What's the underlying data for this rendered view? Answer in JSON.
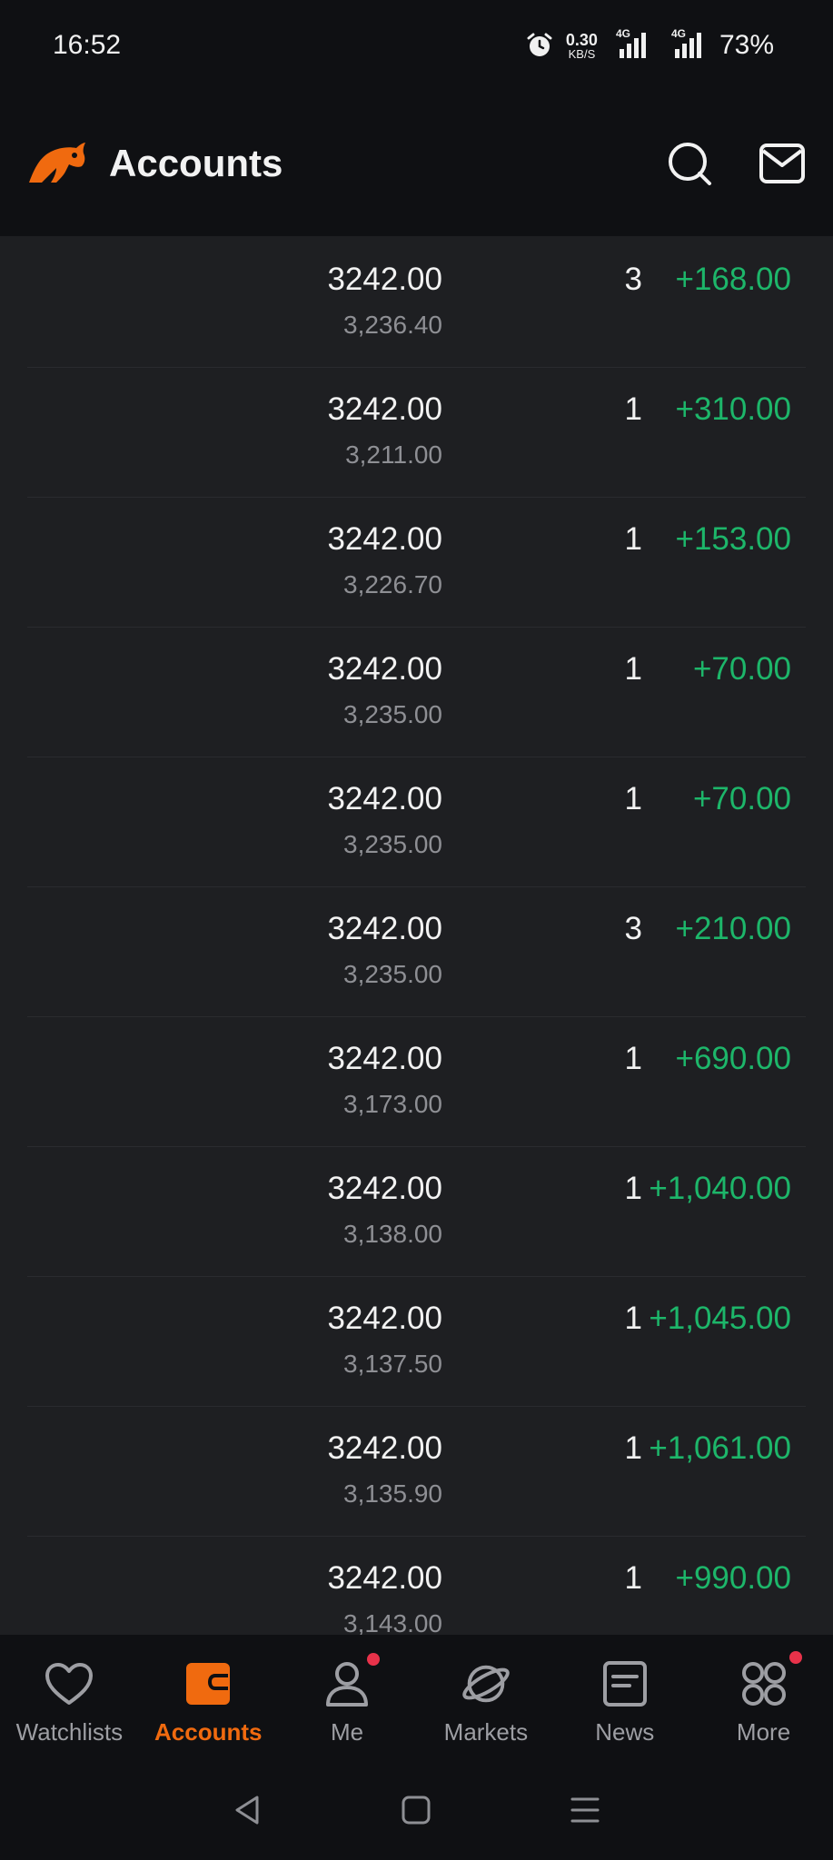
{
  "status_bar": {
    "time": "16:52",
    "net_speed_value": "0.30",
    "net_speed_unit": "KB/S",
    "signal1_tag": "4G",
    "signal2_tag": "4G",
    "battery": "73%"
  },
  "header": {
    "title": "Accounts",
    "icons": [
      "search-icon",
      "mail-icon"
    ]
  },
  "positions": [
    {
      "price": "3242.00",
      "avg": "3,236.40",
      "qty": "3",
      "pl": "+168.00"
    },
    {
      "price": "3242.00",
      "avg": "3,211.00",
      "qty": "1",
      "pl": "+310.00"
    },
    {
      "price": "3242.00",
      "avg": "3,226.70",
      "qty": "1",
      "pl": "+153.00"
    },
    {
      "price": "3242.00",
      "avg": "3,235.00",
      "qty": "1",
      "pl": "+70.00"
    },
    {
      "price": "3242.00",
      "avg": "3,235.00",
      "qty": "1",
      "pl": "+70.00"
    },
    {
      "price": "3242.00",
      "avg": "3,235.00",
      "qty": "3",
      "pl": "+210.00"
    },
    {
      "price": "3242.00",
      "avg": "3,173.00",
      "qty": "1",
      "pl": "+690.00"
    },
    {
      "price": "3242.00",
      "avg": "3,138.00",
      "qty": "1",
      "pl": "+1,040.00"
    },
    {
      "price": "3242.00",
      "avg": "3,137.50",
      "qty": "1",
      "pl": "+1,045.00"
    },
    {
      "price": "3242.00",
      "avg": "3,135.90",
      "qty": "1",
      "pl": "+1,061.00"
    },
    {
      "price": "3242.00",
      "avg": "3,143.00",
      "qty": "1",
      "pl": "+990.00"
    }
  ],
  "bottom_nav": [
    {
      "label": "Watchlists",
      "icon": "heart-icon"
    },
    {
      "label": "Accounts",
      "icon": "wallet-icon",
      "active": true
    },
    {
      "label": "Me",
      "icon": "person-icon",
      "badge": true
    },
    {
      "label": "Markets",
      "icon": "planet-icon"
    },
    {
      "label": "News",
      "icon": "news-icon"
    },
    {
      "label": "More",
      "icon": "grid-icon",
      "badge": true
    }
  ],
  "colors": {
    "accent": "#f06a0f",
    "profit": "#1db66a",
    "background": "#1e1f22",
    "header_bg": "#0f1013",
    "badge": "#e8324a"
  }
}
